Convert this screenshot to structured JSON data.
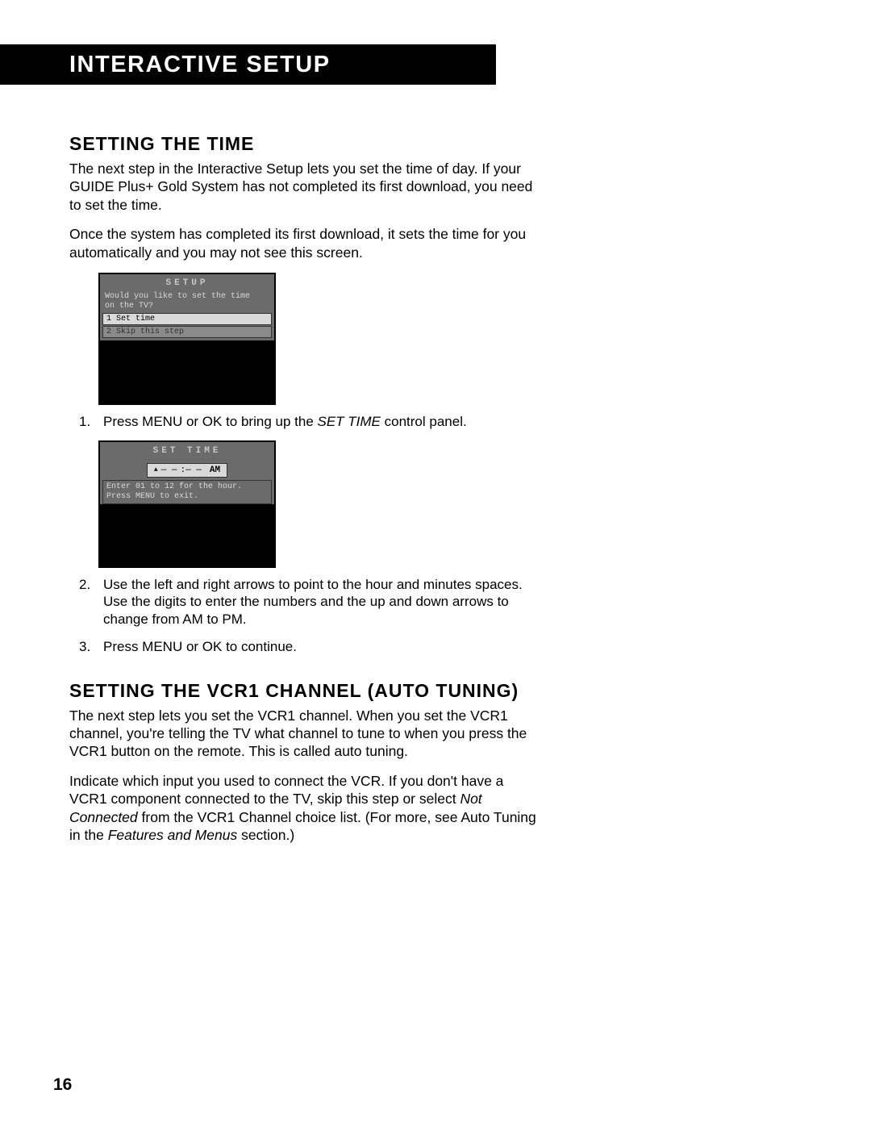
{
  "header": {
    "title": "Interactive Setup"
  },
  "section1": {
    "heading": "Setting the Time",
    "para1": "The next step in the Interactive Setup lets you set the time of day. If your GUIDE Plus+ Gold System has not completed its first download, you need to set the time.",
    "para2": "Once the system has completed its first download, it sets the time for you automatically and you may not see this screen.",
    "setup_panel": {
      "title": "SETUP",
      "prompt_line1": "Would you like to set the time",
      "prompt_line2": "on the TV?",
      "option1": "1 Set time",
      "option2": "2 Skip this step"
    },
    "step1_a": "Press MENU or OK to bring up the ",
    "step1_em": "SET TIME",
    "step1_b": " control panel.",
    "settime_panel": {
      "title": "SET TIME",
      "time_display_left": "— —",
      "time_display_mid": ":— —",
      "time_display_ampm": "AM",
      "help1": "Enter 01 to 12 for the hour.",
      "help2": "Press MENU to exit."
    },
    "step2": "Use the left and right arrows to point to the hour and minutes spaces. Use the digits to enter the numbers and the up and down arrows to change from AM to PM.",
    "step3": "Press  MENU or OK to continue."
  },
  "section2": {
    "heading": "Setting the  VCR1 Channel (Auto Tuning)",
    "para1": "The next step lets you set the VCR1 channel. When you set the VCR1 channel, you're telling the TV what channel to tune to when you press the VCR1 button on the remote. This is called auto tuning.",
    "para2_a": "Indicate which input you used to connect the VCR.  If you don't have a VCR1 component connected to the TV, skip this step or select ",
    "para2_em": "Not Connected",
    "para2_b": " from the VCR1 Channel choice list. (For more, see Auto Tuning in the ",
    "para2_em2": "Features and Menus",
    "para2_c": " section.)"
  },
  "page_number": "16"
}
